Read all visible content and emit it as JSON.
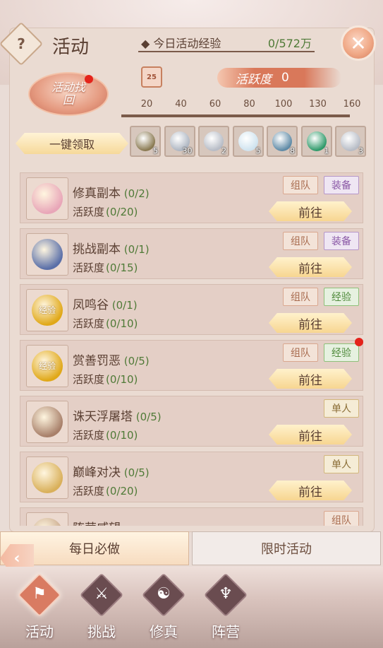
{
  "header": {
    "help_label": "?",
    "title": "活动",
    "exp_label": "今日活动经验",
    "exp_value": "0/572万",
    "close_label": "✕"
  },
  "activity": {
    "recall_label": "活动找回",
    "calendar_day": "25",
    "activity_label": "活跃度",
    "activity_value": "0",
    "milestones": [
      "20",
      "40",
      "60",
      "80",
      "100",
      "130",
      "160"
    ],
    "progress": 0
  },
  "claim_all_label": "一键领取",
  "rewards": [
    {
      "icon": "jade-token-icon",
      "count": "5",
      "color": "#8a7a52"
    },
    {
      "icon": "silver-coin-icon",
      "count": "30",
      "color": "#aeb6c2"
    },
    {
      "icon": "silver-ingot-icon",
      "count": "2",
      "color": "#b7bcc6"
    },
    {
      "icon": "crystal-icon",
      "count": "5",
      "color": "#cfe3ef"
    },
    {
      "icon": "treasure-box-icon",
      "count": "8",
      "color": "#5e8aa6"
    },
    {
      "icon": "emerald-icon",
      "count": "1",
      "color": "#2f9a6a"
    },
    {
      "icon": "silver-ingot-icon",
      "count": "3",
      "color": "#b7bcc6"
    }
  ],
  "tasks": [
    {
      "name": "修真副本",
      "count": "(0/2)",
      "act_label": "活跃度",
      "act_value": "(0/20)",
      "tags": [
        {
          "label": "组队",
          "type": "team"
        },
        {
          "label": "装备",
          "type": "equip"
        }
      ],
      "go": "前往",
      "icon": "lotus-icon",
      "orb": "#e8a6b8"
    },
    {
      "name": "挑战副本",
      "count": "(0/1)",
      "act_label": "活跃度",
      "act_value": "(0/15)",
      "tags": [
        {
          "label": "组队",
          "type": "team"
        },
        {
          "label": "装备",
          "type": "equip"
        }
      ],
      "go": "前往",
      "icon": "chest-icon",
      "orb": "#5a6fa8"
    },
    {
      "name": "凤鸣谷",
      "count": "(0/1)",
      "act_label": "活跃度",
      "act_value": "(0/10)",
      "tags": [
        {
          "label": "组队",
          "type": "team"
        },
        {
          "label": "经验",
          "type": "exp"
        }
      ],
      "go": "前往",
      "icon": "exp-orb-icon",
      "orb": "#e0a818",
      "orb_text": "经验"
    },
    {
      "name": "赏善罚恶",
      "count": "(0/5)",
      "act_label": "活跃度",
      "act_value": "(0/10)",
      "tags": [
        {
          "label": "组队",
          "type": "team"
        },
        {
          "label": "经验",
          "type": "exp"
        }
      ],
      "go": "前往",
      "icon": "exp-orb-icon",
      "orb": "#e0a818",
      "orb_text": "经验",
      "dot": true
    },
    {
      "name": "诛天浮屠塔",
      "count": "(0/5)",
      "act_label": "活跃度",
      "act_value": "(0/10)",
      "tags": [
        {
          "label": "单人",
          "type": "solo"
        }
      ],
      "go": "前往",
      "icon": "pagoda-orb-icon",
      "orb": "#a8806a"
    },
    {
      "name": "巅峰对决",
      "count": "(0/5)",
      "act_label": "活跃度",
      "act_value": "(0/20)",
      "tags": [
        {
          "label": "单人",
          "type": "solo"
        }
      ],
      "go": "前往",
      "icon": "star-emblem-icon",
      "orb": "#d9b05a"
    },
    {
      "name": "阵营威望",
      "count": "",
      "act_label": "",
      "act_value": "",
      "tags": [
        {
          "label": "组队",
          "type": "team"
        }
      ],
      "go": "",
      "icon": "banner-icon",
      "orb": "#c9a88b"
    }
  ],
  "tabs": {
    "daily": "每日必做",
    "limited": "限时活动"
  },
  "nav": [
    {
      "label": "活动",
      "icon": "flag-icon",
      "glyph": "⚑",
      "active": true
    },
    {
      "label": "挑战",
      "icon": "crossed-swords-icon",
      "glyph": "⚔",
      "active": false
    },
    {
      "label": "修真",
      "icon": "swirl-icon",
      "glyph": "☯",
      "active": false
    },
    {
      "label": "阵营",
      "icon": "winged-emblem-icon",
      "glyph": "♆",
      "active": false
    }
  ]
}
